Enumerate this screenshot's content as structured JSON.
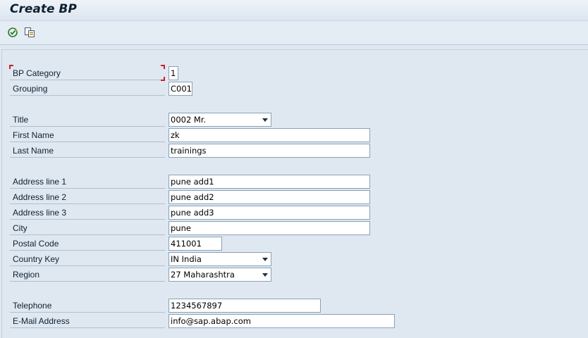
{
  "window": {
    "title": "Create BP"
  },
  "toolbar": {
    "icons": [
      "execute-check-icon",
      "copy-document-icon"
    ]
  },
  "form": {
    "bp_category": {
      "label": "BP Category",
      "value": "1"
    },
    "grouping": {
      "label": "Grouping",
      "value": "C001"
    },
    "title": {
      "label": "Title",
      "value": "0002 Mr."
    },
    "first_name": {
      "label": "First Name",
      "value": "zk"
    },
    "last_name": {
      "label": "Last Name",
      "value": "trainings"
    },
    "address_line_1": {
      "label": "Address line 1",
      "value": "pune add1"
    },
    "address_line_2": {
      "label": "Address line 2",
      "value": "pune add2"
    },
    "address_line_3": {
      "label": "Address line 3",
      "value": "pune add3"
    },
    "city": {
      "label": "City",
      "value": "pune"
    },
    "postal_code": {
      "label": "Postal Code",
      "value": "411001"
    },
    "country_key": {
      "label": "Country Key",
      "value": "IN India"
    },
    "region": {
      "label": "Region",
      "value": "27 Maharashtra"
    },
    "telephone": {
      "label": "Telephone",
      "value": "1234567897"
    },
    "email": {
      "label": "E-Mail Address",
      "value": "info@sap.abap.com"
    }
  },
  "colors": {
    "background": "#dfe8f1",
    "focus_marker": "#c8202a"
  }
}
